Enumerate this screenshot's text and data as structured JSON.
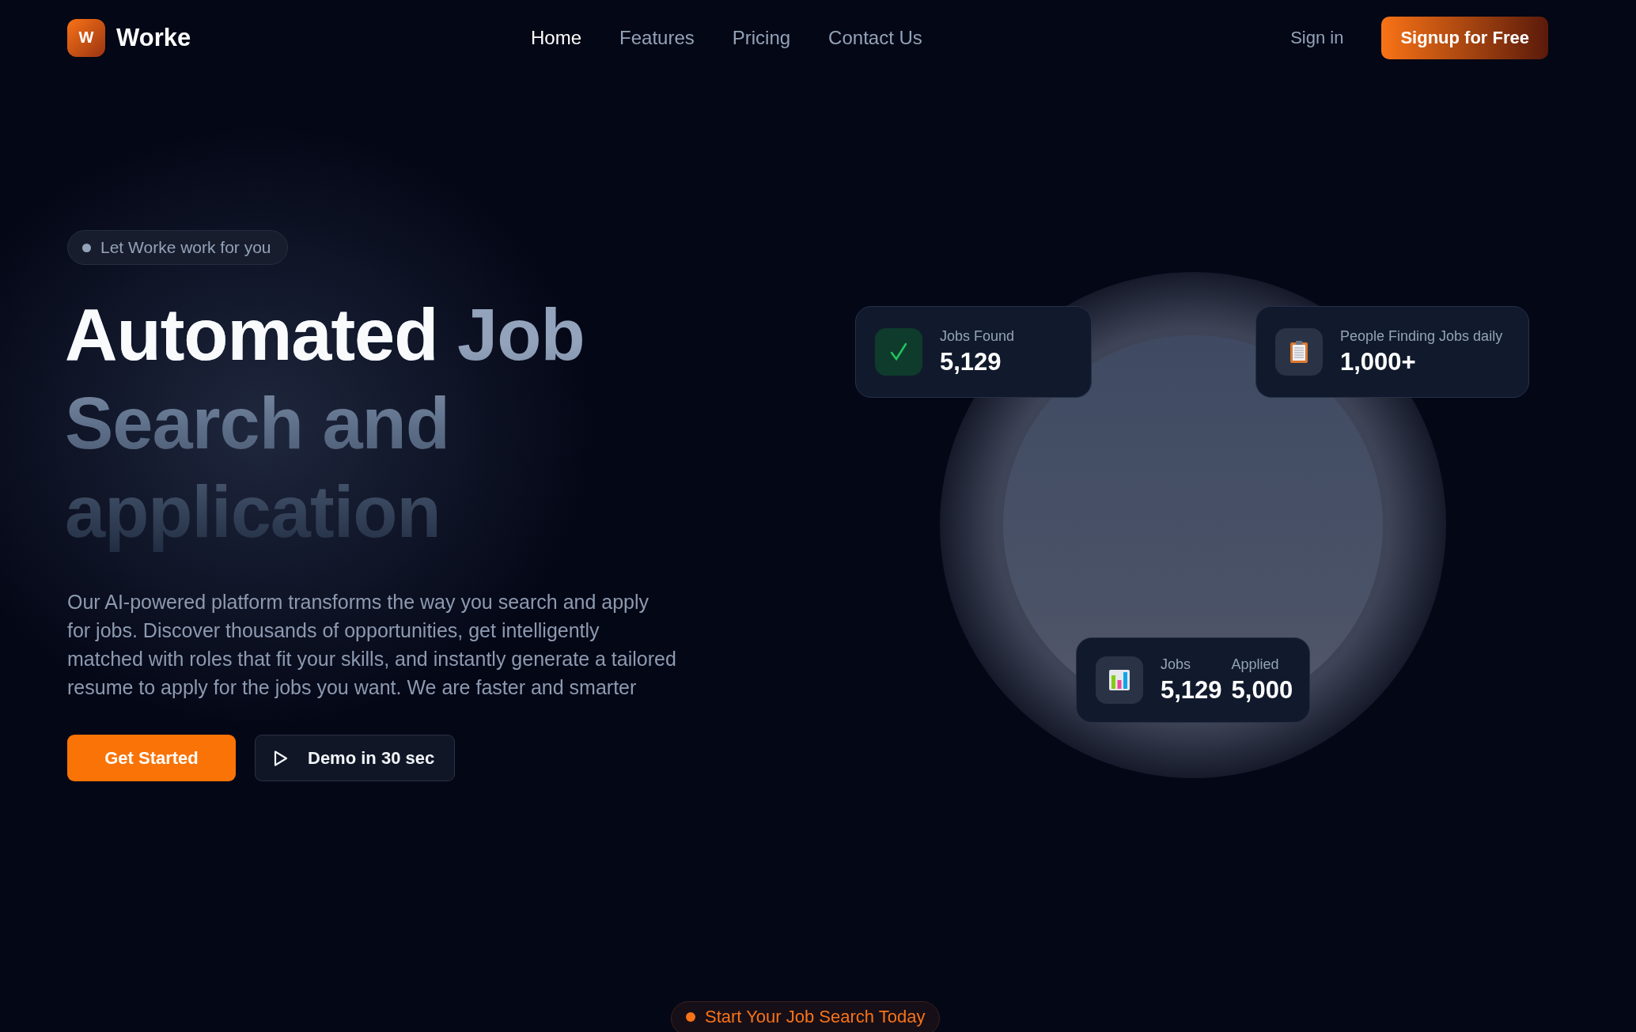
{
  "brand": {
    "logo_letter": "W",
    "name": "Worke"
  },
  "nav": [
    {
      "label": "Home",
      "selected": true
    },
    {
      "label": "Features",
      "selected": false
    },
    {
      "label": "Pricing",
      "selected": false
    },
    {
      "label": "Contact Us",
      "selected": false
    }
  ],
  "sign_in": "Sign in",
  "signup": "Signup for Free",
  "hero": {
    "tag": "Let Worke work for you",
    "title_lines": [
      [
        {
          "text": "Automated",
          "highlight": true
        },
        {
          "text": "Job",
          "highlight": false
        }
      ],
      [
        {
          "text": "Search and",
          "highlight": false
        }
      ],
      [
        {
          "text": "application",
          "highlight": false
        }
      ]
    ],
    "description": "Our AI-powered platform transforms the way you search and apply for jobs. Discover thousands of opportunities, get intelligently matched with roles that fit your skills, and instantly generate a tailored resume to apply for the jobs you want. We are faster and smarter",
    "primary_button": "Get Started",
    "demo_button": "Demo in 30 sec"
  },
  "cards": [
    {
      "kind": "check",
      "stats": [
        {
          "label": "Jobs Found",
          "value": "5,129"
        }
      ]
    },
    {
      "kind": "clipboard",
      "stats": [
        {
          "label": "People Finding Jobs daily",
          "value": "1,000+"
        }
      ]
    },
    {
      "kind": "chart",
      "stats": [
        {
          "label": "Jobs",
          "value": "5,129"
        },
        {
          "label": "Applied",
          "value": "5,000"
        }
      ]
    }
  ],
  "next_section_tag": "Start Your Job Search Today"
}
